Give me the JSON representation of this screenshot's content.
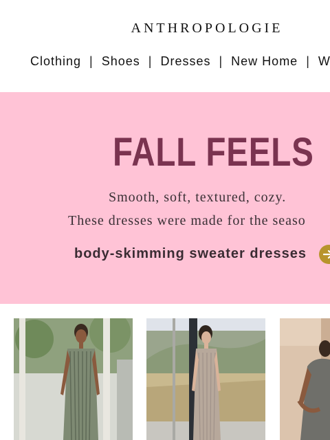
{
  "header": {
    "logo": "ANTHROPOLOGIE",
    "nav": [
      {
        "label": "Clothing"
      },
      {
        "label": "Shoes"
      },
      {
        "label": "Dresses"
      },
      {
        "label": "New Home"
      },
      {
        "label": "W"
      }
    ],
    "separator": "|"
  },
  "hero": {
    "headline": "FALL FEELS",
    "subline1": "Smooth, soft, textured, cozy.",
    "subline2": "These dresses were made for the seaso",
    "cta_label": "body-skimming sweater dresses",
    "cta_icon": "arrow-right-icon",
    "background_color": "#ffc3d6",
    "headline_color": "#7a3350",
    "cta_icon_color": "#b8942c"
  },
  "products": [
    {
      "name": "green-ribbed-dress-photo"
    },
    {
      "name": "taupe-knit-dress-photo"
    },
    {
      "name": "grey-tee-dress-photo"
    }
  ]
}
